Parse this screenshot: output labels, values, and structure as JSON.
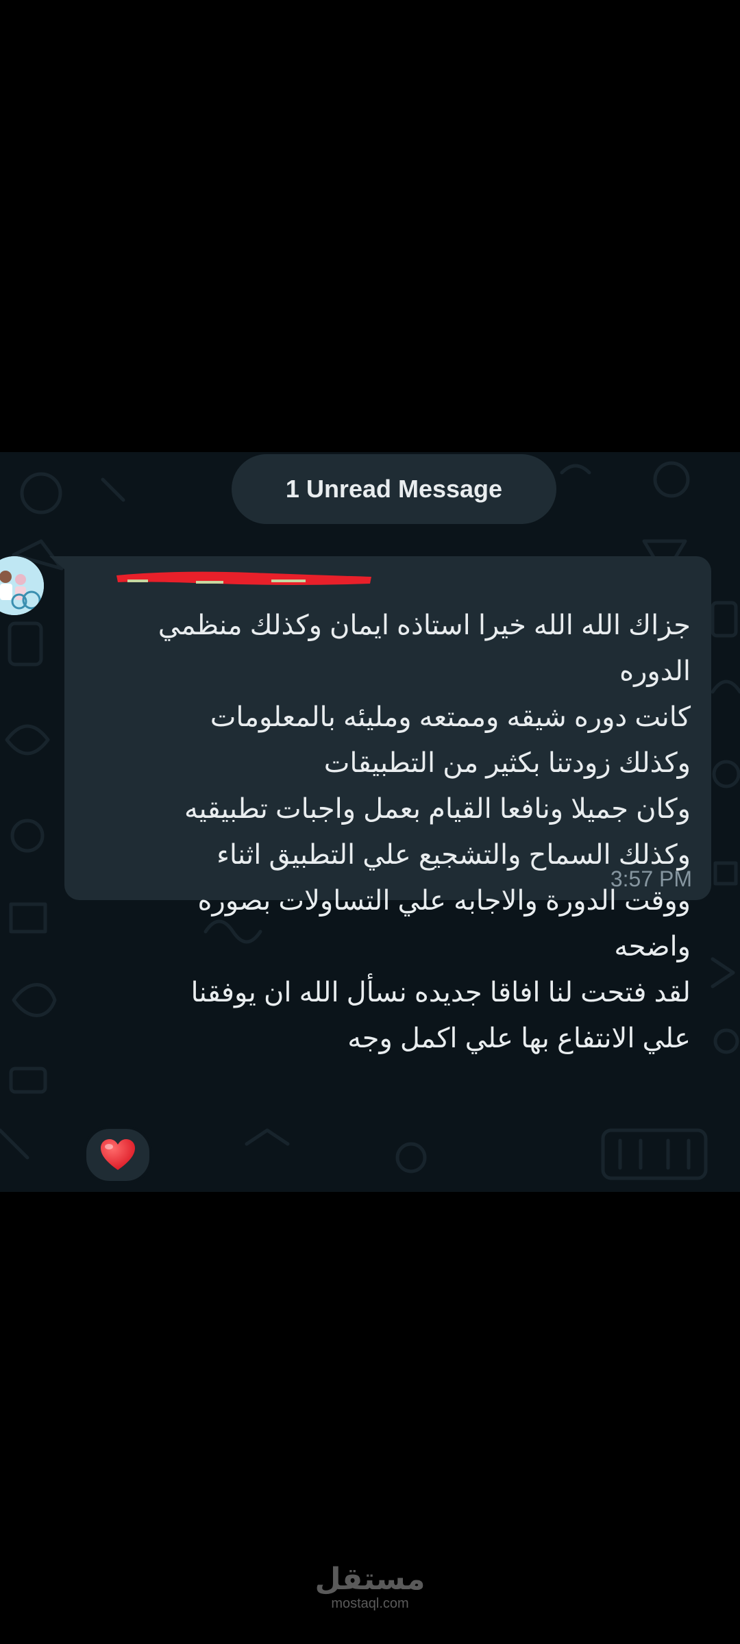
{
  "chat": {
    "unread_label": "1 Unread Message",
    "message": {
      "lines": [
        "جزاك الله الله خيرا استاذه ايمان وكذلك منظمي",
        "الدوره",
        "كانت دوره شيقه وممتعه ومليئه بالمعلومات",
        "وكذلك زودتنا بكثير من التطبيقات",
        "وكان جميلا ونافعا القيام بعمل واجبات تطبيقيه",
        "وكذلك السماح والتشجيع علي  التطبيق اثناء",
        "ووقت الدورة والاجابه علي التساولات بصوره",
        "واضحه",
        "لقد فتحت لنا افاقا جديده نسأل الله ان يوفقنا",
        "علي الانتفاع بها علي اكمل وجه"
      ],
      "time": "3:57 PM"
    },
    "reaction_icon": "red-heart-icon"
  },
  "colors": {
    "screen_bg": "#000000",
    "chat_bg": "#0b141a",
    "bubble_bg": "#1f2c34",
    "text": "#e9edef",
    "meta_text": "#8696a0",
    "redaction": "#e8202a"
  },
  "watermark": {
    "main": "مستقل",
    "sub": "mostaql.com"
  }
}
